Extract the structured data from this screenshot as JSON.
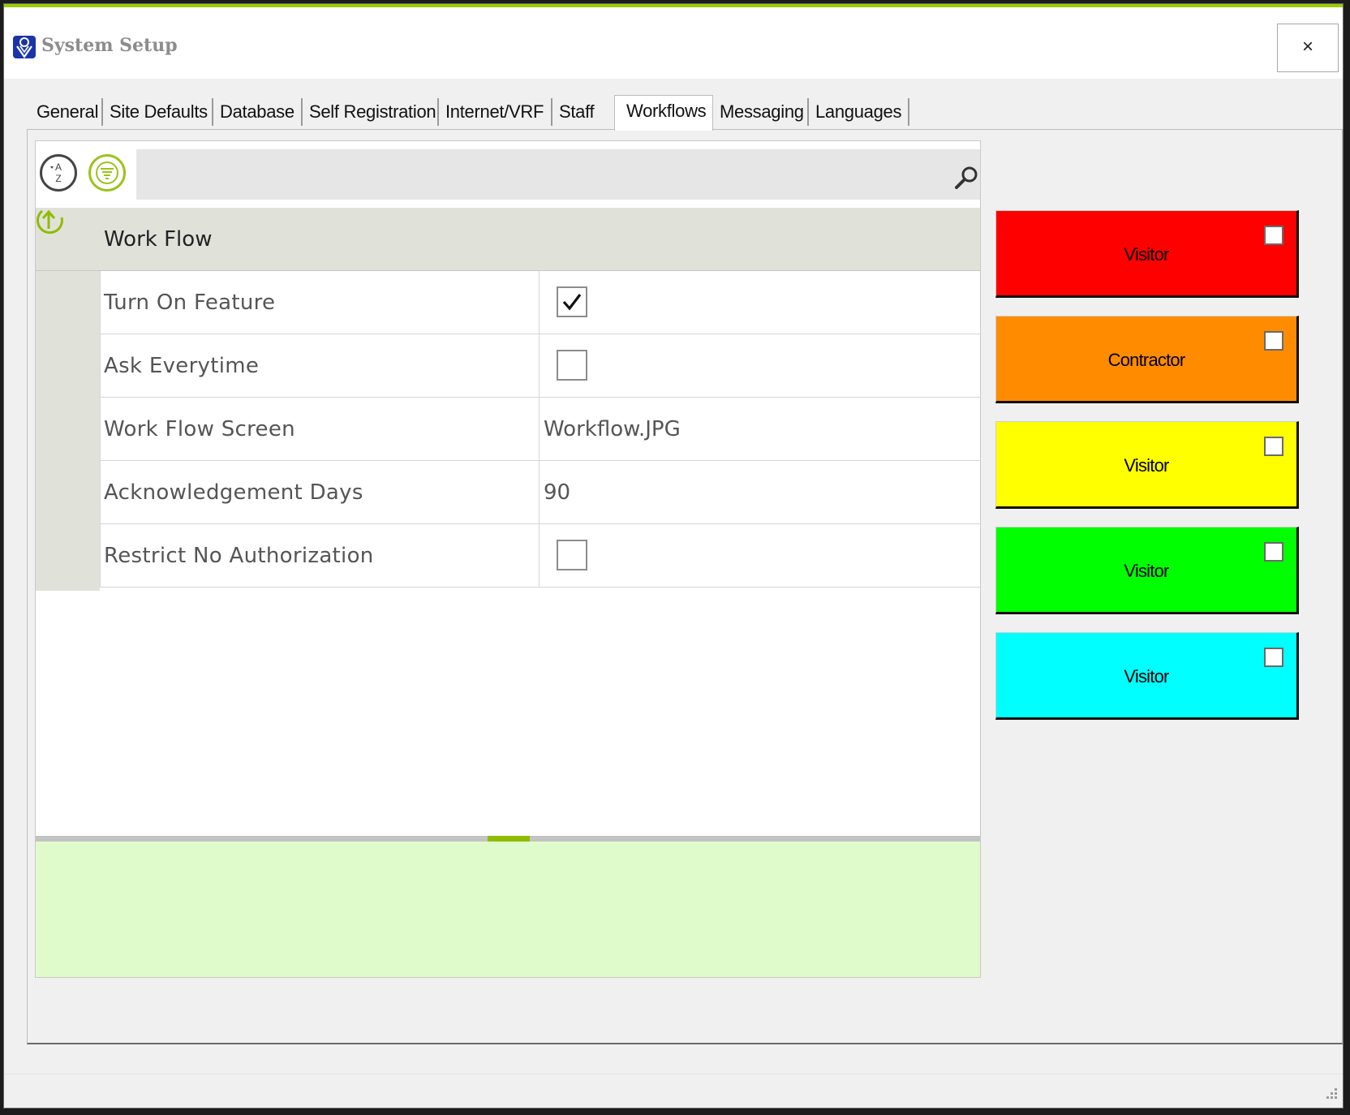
{
  "window": {
    "title": "System Setup",
    "close_label": "×",
    "accent": "#9ccc00"
  },
  "tabs": [
    {
      "label": "General"
    },
    {
      "label": "Site Defaults"
    },
    {
      "label": "Database"
    },
    {
      "label": "Self Registration"
    },
    {
      "label": "Internet/VRF"
    },
    {
      "label": "Staff"
    },
    {
      "label": "Workflows",
      "active": true
    },
    {
      "label": "Messaging"
    },
    {
      "label": "Languages"
    }
  ],
  "toolbar": {
    "sort_icon": "sort-alphabetical-icon",
    "categorize_icon": "categorized-icon",
    "search_icon": "search-icon",
    "search_value": ""
  },
  "property_grid": {
    "category": "Work Flow",
    "rows": [
      {
        "name": "Turn On Feature",
        "type": "checkbox",
        "checked": true
      },
      {
        "name": "Ask Everytime",
        "type": "checkbox",
        "checked": false
      },
      {
        "name": "Work Flow Screen",
        "type": "text",
        "value": "Workflow.JPG"
      },
      {
        "name": "Acknowledgement Days",
        "type": "text",
        "value": "90"
      },
      {
        "name": "Restrict No Authorization",
        "type": "checkbox",
        "checked": false
      }
    ],
    "description": ""
  },
  "workflow_buttons": [
    {
      "label": "Visitor",
      "color": "#ff0000",
      "checked": false
    },
    {
      "label": "Contractor",
      "color": "#ff8c00",
      "checked": false
    },
    {
      "label": "Visitor",
      "color": "#ffff00",
      "checked": false
    },
    {
      "label": "Visitor",
      "color": "#00ff00",
      "checked": false
    },
    {
      "label": "Visitor",
      "color": "#00ffff",
      "checked": false
    }
  ]
}
